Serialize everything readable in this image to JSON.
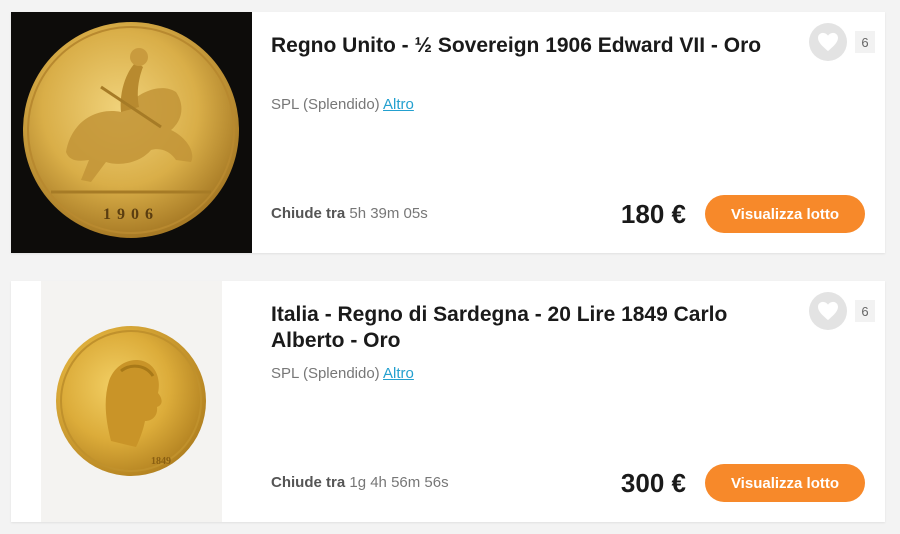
{
  "lots": [
    {
      "title": "Regno Unito - ½ Sovereign 1906 Edward VII - Oro",
      "grade": "SPL (Splendido)",
      "grade_link": "Altro",
      "closes_label": "Chiude tra",
      "closes_time": "5h 39m 05s",
      "price": "180 €",
      "button_label": "Visualizza lotto",
      "favorites": "6",
      "coin_legend": "1906",
      "image": "gold-sovereign-coin-image"
    },
    {
      "title": "Italia - Regno di Sardegna - 20 Lire 1849 Carlo Alberto - Oro",
      "grade": "SPL (Splendido)",
      "grade_link": "Altro",
      "closes_label": "Chiude tra",
      "closes_time": "1g 4h 56m 56s",
      "price": "300 €",
      "button_label": "Visualizza lotto",
      "favorites": "6",
      "coin_legend": "1849",
      "image": "gold-20-lire-coin-image"
    }
  ],
  "colors": {
    "accent": "#f7892a",
    "link": "#23a0cf",
    "background": "#f3f3f3",
    "card": "#ffffff"
  },
  "icons": {
    "favorite": "heart-icon"
  }
}
